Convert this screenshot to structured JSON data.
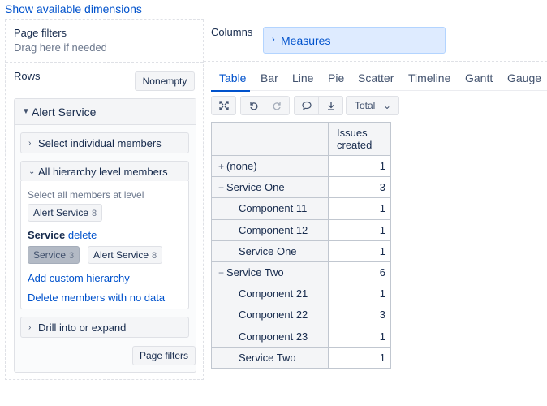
{
  "top_link": "Show available dimensions",
  "page_filters": {
    "title": "Page filters",
    "hint": "Drag here if needed"
  },
  "rows": {
    "title": "Rows",
    "nonempty_label": "Nonempty",
    "dimension": {
      "title": "Alert Service",
      "select_individual": "Select individual members",
      "all_hierarchy": {
        "title": "All hierarchy level members",
        "select_all_hint": "Select all members at level",
        "level_chip": {
          "label": "Alert Service",
          "count": "8"
        },
        "selected_level_label": "Service",
        "delete_link": "delete",
        "level_chips": [
          {
            "label": "Service",
            "count": "3"
          },
          {
            "label": "Alert Service",
            "count": "8"
          }
        ],
        "add_custom_hierarchy": "Add custom hierarchy",
        "delete_no_data": "Delete members with no data"
      },
      "drill": "Drill into or expand"
    },
    "page_filters_button": "Page filters"
  },
  "columns": {
    "title": "Columns",
    "measures_label": "Measures"
  },
  "tabs": [
    "Table",
    "Bar",
    "Line",
    "Pie",
    "Scatter",
    "Timeline",
    "Gantt",
    "Gauge"
  ],
  "active_tab": "Table",
  "toolbar": {
    "total_label": "Total"
  },
  "table": {
    "column_header": "Issues created",
    "rows": [
      {
        "label": "(none)",
        "value": "1",
        "level": 0,
        "expander": "+"
      },
      {
        "label": "Service One",
        "value": "3",
        "level": 0,
        "expander": "−"
      },
      {
        "label": "Component 11",
        "value": "1",
        "level": 1
      },
      {
        "label": "Component 12",
        "value": "1",
        "level": 1
      },
      {
        "label": "Service One",
        "value": "1",
        "level": 1
      },
      {
        "label": "Service Two",
        "value": "6",
        "level": 0,
        "expander": "−"
      },
      {
        "label": "Component 21",
        "value": "1",
        "level": 1
      },
      {
        "label": "Component 22",
        "value": "3",
        "level": 1
      },
      {
        "label": "Component 23",
        "value": "1",
        "level": 1
      },
      {
        "label": "Service Two",
        "value": "1",
        "level": 1
      }
    ]
  }
}
